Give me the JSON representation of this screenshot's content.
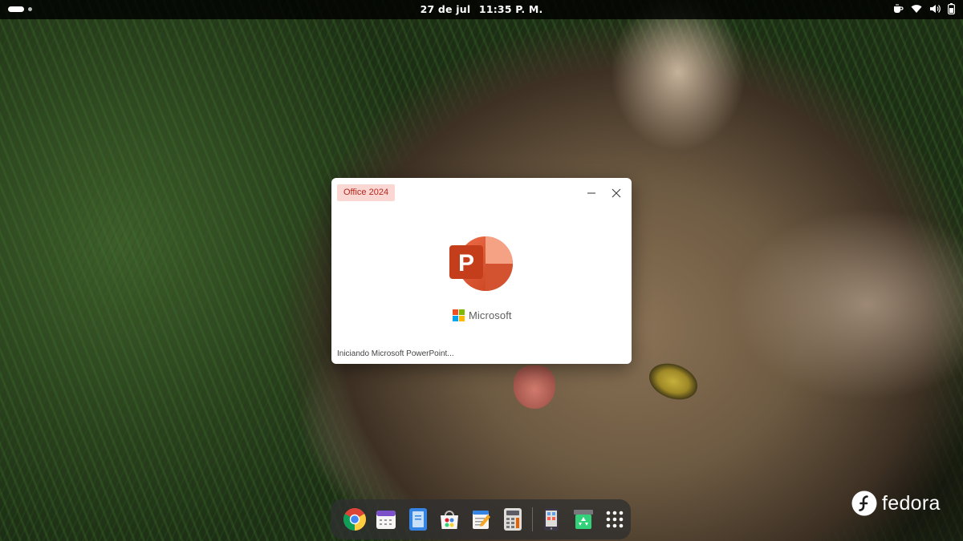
{
  "topbar": {
    "date": "27 de jul",
    "time": "11:35 P. M.",
    "tray_icons": [
      "tea-icon",
      "wifi-icon",
      "volume-icon",
      "battery-icon"
    ]
  },
  "splash": {
    "badge": "Office 2024",
    "brand_text": "Microsoft",
    "app_letter": "P",
    "status_text": "Iniciando Microsoft PowerPoint...",
    "colors": {
      "badge_bg": "#fad7d2",
      "badge_fg": "#b5261e",
      "ppt_primary": "#c43e1c",
      "ppt_accent": "#ed6c47"
    }
  },
  "dock": {
    "items": [
      "chrome-icon",
      "calendar-icon",
      "document-viewer-icon",
      "software-store-icon",
      "text-editor-icon",
      "calculator-icon",
      "phone-icon",
      "recycle-icon",
      "app-grid-icon"
    ]
  },
  "brand": {
    "wordmark": "fedora"
  }
}
